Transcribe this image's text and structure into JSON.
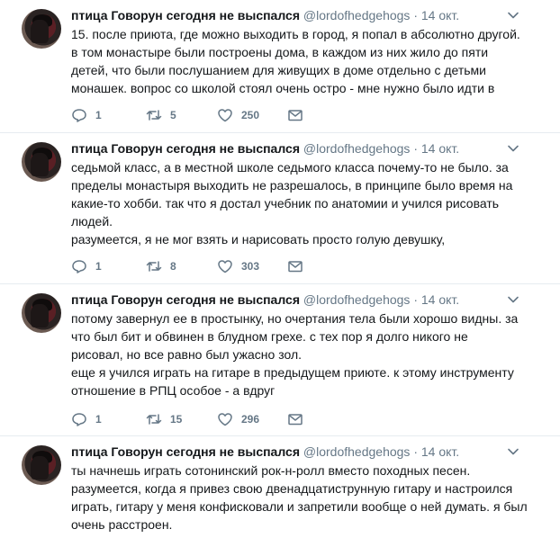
{
  "tweets": [
    {
      "name": "птица Говорун сегодня не выспался",
      "handle": "@lordofhedgehogs",
      "dot": "·",
      "date": "14 окт.",
      "lines": [
        "15. после приюта, где можно выходить в город, я попал в абсолютно другой.",
        "в том монастыре были построены дома, в каждом из них жило до пяти",
        "детей, что были послушанием для живущих в доме отдельно с детьми",
        "монашек. вопрос со школой стоял очень остро - мне нужно было идти в"
      ],
      "replies": "1",
      "retweets": "5",
      "likes": "250"
    },
    {
      "name": "птица Говорун сегодня не выспался",
      "handle": "@lordofhedgehogs",
      "dot": "·",
      "date": "14 окт.",
      "lines": [
        "седьмой класс, а в местной школе седьмого класса почему-то не было. за",
        "пределы монастыря выходить не разрешалось, в принципе было время на",
        "какие-то хобби. так что я достал учебник по анатомии и учился рисовать",
        "людей.",
        "разумеется, я не мог взять и нарисовать просто голую девушку,"
      ],
      "replies": "1",
      "retweets": "8",
      "likes": "303"
    },
    {
      "name": "птица Говорун сегодня не выспался",
      "handle": "@lordofhedgehogs",
      "dot": "·",
      "date": "14 окт.",
      "lines": [
        "потому завернул ее в простынку, но очертания тела были хорошо видны. за",
        "что был бит и обвинен в блудном грехе. с тех пор я долго никого не",
        "рисовал, но все равно был ужасно зол.",
        "еще я учился играть на гитаре в предыдущем приюте. к этому инструменту",
        "отношение в РПЦ особое - а вдруг"
      ],
      "replies": "1",
      "retweets": "15",
      "likes": "296"
    },
    {
      "name": "птица Говорун сегодня не выспался",
      "handle": "@lordofhedgehogs",
      "dot": "·",
      "date": "14 окт.",
      "lines": [
        "ты начнешь играть сотонинский рок-н-ролл вместо походных песен.",
        "разумеется, когда я привез свою двенадцатиструнную гитару и настроился",
        "играть, гитару у меня конфисковали и запретили вообще о ней думать. я был",
        "очень расстроен."
      ]
    }
  ]
}
